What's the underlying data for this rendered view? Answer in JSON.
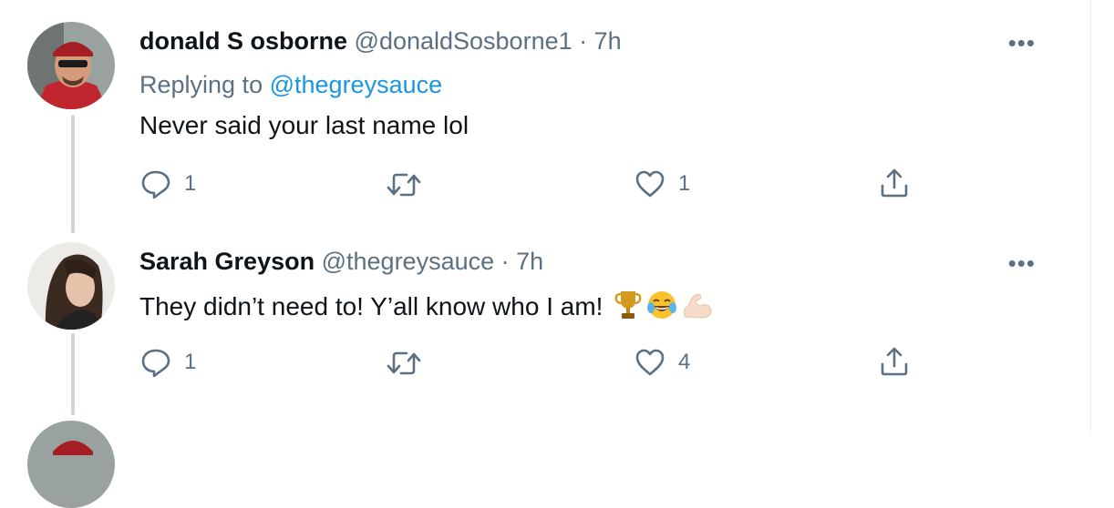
{
  "tweets": [
    {
      "name": "donald S osborne",
      "handle": "@donaldSosborne1",
      "dot": "·",
      "time": "7h",
      "replying_prefix": "Replying to",
      "replying_to": "@thegreysauce",
      "text": "Never said your last name lol",
      "more": "•••",
      "reply_count": "1",
      "retweet_count": "",
      "like_count": "1"
    },
    {
      "name": "Sarah Greyson",
      "handle": "@thegreysauce",
      "dot": "·",
      "time": "7h",
      "text": "They didn’t need to! Y’all know who I am!",
      "emojis": [
        "trophy-icon",
        "joy-face-icon",
        "flexed-biceps-icon"
      ],
      "more": "•••",
      "reply_count": "1",
      "retweet_count": "",
      "like_count": "4"
    }
  ],
  "colors": {
    "text": "#0f1419",
    "secondary": "#5b7083",
    "link": "#1b95e0",
    "thread_line": "#ccd6dd"
  }
}
